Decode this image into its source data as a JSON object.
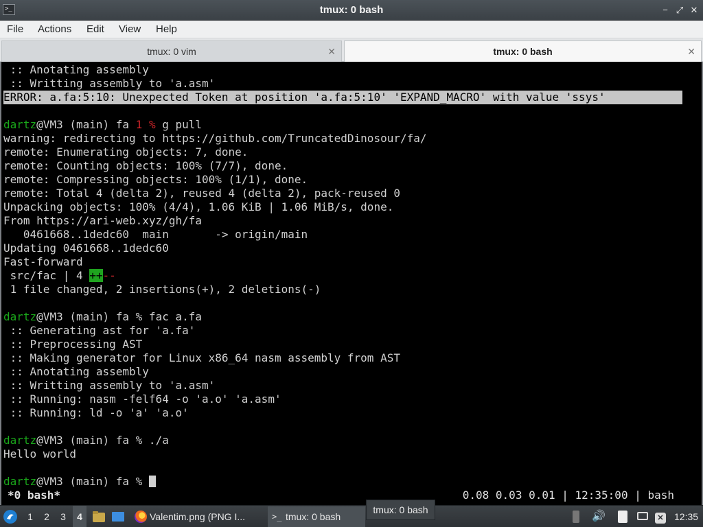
{
  "window": {
    "title": "tmux: 0 bash"
  },
  "menu": [
    "File",
    "Actions",
    "Edit",
    "View",
    "Help"
  ],
  "tabs": [
    {
      "label": "tmux: 0 vim",
      "active": false
    },
    {
      "label": "tmux: 0 bash",
      "active": true
    }
  ],
  "terminal": {
    "lines": [
      " :: Anotating assembly",
      " :: Writting assembly to 'a.asm'",
      "ERROR: a.fa:5:10: Unexpected Token at position 'a.fa:5:10' 'EXPAND_MACRO' with value 'ssys'",
      "",
      {
        "user": "dartz",
        "host": "@VM3 (main) fa ",
        "code": "1 %",
        "cmd": " g pull"
      },
      "warning: redirecting to https://github.com/TruncatedDinosour/fa/",
      "remote: Enumerating objects: 7, done.",
      "remote: Counting objects: 100% (7/7), done.",
      "remote: Compressing objects: 100% (1/1), done.",
      "remote: Total 4 (delta 2), reused 4 (delta 2), pack-reused 0",
      "Unpacking objects: 100% (4/4), 1.06 KiB | 1.06 MiB/s, done.",
      "From https://ari-web.xyz/gh/fa",
      "   0461668..1dedc60  main       -> origin/main",
      "Updating 0461668..1dedc60",
      "Fast-forward",
      {
        "stat": " src/fac | 4 ",
        "add": "++",
        "del": "--"
      },
      " 1 file changed, 2 insertions(+), 2 deletions(-)",
      "",
      {
        "user": "dartz",
        "host": "@VM3 (main) fa % fac a.fa"
      },
      " :: Generating ast for 'a.fa'",
      " :: Preprocessing AST",
      " :: Making generator for Linux x86_64 nasm assembly from AST",
      " :: Anotating assembly",
      " :: Writting assembly to 'a.asm'",
      " :: Running: nasm -felf64 -o 'a.o' 'a.asm'",
      " :: Running: ld -o 'a' 'a.o'",
      "",
      {
        "user": "dartz",
        "host": "@VM3 (main) fa % ./a"
      },
      "Hello world",
      "",
      {
        "user": "dartz",
        "host": "@VM3 (main) fa % ",
        "cursor": true
      }
    ]
  },
  "tmux_status": {
    "left": "*0 bash*",
    "right": "0.08 0.03 0.01 | 12:35:00 | bash"
  },
  "taskbar": {
    "workspaces": [
      "1",
      "2",
      "3",
      "4"
    ],
    "active_workspace": "4",
    "tasks": [
      {
        "label": "Valentim.png (PNG I..."
      },
      {
        "label": "tmux: 0 bash"
      }
    ],
    "tooltip": "tmux: 0 bash",
    "clock": "12:35"
  },
  "colors": {
    "prompt_user": "#1aa81a",
    "exit_code": "#d6262b",
    "error_bg": "#c6c6c6"
  }
}
